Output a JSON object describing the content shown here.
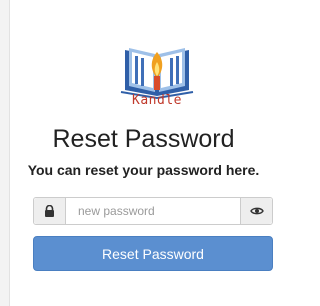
{
  "brand": {
    "name": "Kandle"
  },
  "page": {
    "title": "Reset Password",
    "subtitle": "You can reset your password here."
  },
  "form": {
    "password": {
      "placeholder": "new password",
      "value": ""
    },
    "submit_label": "Reset Password"
  },
  "icons": {
    "lock": "lock-icon",
    "show_password": "eye-icon"
  },
  "colors": {
    "primary_button": "#5b8fd0",
    "logo_text": "#c0392b"
  }
}
